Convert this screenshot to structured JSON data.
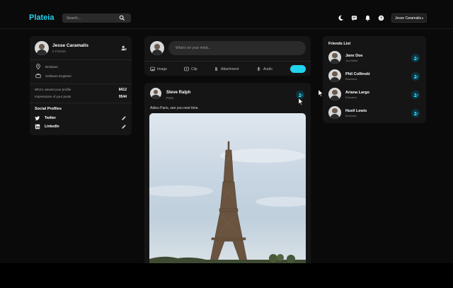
{
  "brand": {
    "logo": "Plateia",
    "accent": "#22d3ee"
  },
  "search": {
    "placeholder": "Search..."
  },
  "nav": {
    "user_label": "Jesse Caramalis",
    "icons": [
      "moon-icon",
      "chat-icon",
      "bell-icon",
      "help-icon"
    ]
  },
  "profile": {
    "name": "Jesse Caramalis",
    "friends": "5 Friends",
    "location": "Brisbane",
    "job": "Software Engineer",
    "stats": [
      {
        "label": "Who's viewed your profile",
        "value": "8412"
      },
      {
        "label": "Impressions of your posts",
        "value": "9544"
      }
    ],
    "social_title": "Social Profiles",
    "social": [
      {
        "label": "Twitter"
      },
      {
        "label": "LinkedIn"
      }
    ]
  },
  "composer": {
    "placeholder": "What's on your mind...",
    "actions": [
      "Image",
      "Clip",
      "Attachment",
      "Audio"
    ]
  },
  "post": {
    "author": "Steve Ralph",
    "location": "Paris",
    "text": "Adieu Paris, see you next time."
  },
  "friends": {
    "title": "Friends List",
    "items": [
      {
        "name": "Jane Doe",
        "role": "Journalist"
      },
      {
        "name": "Phil Collinski",
        "role": "Business"
      },
      {
        "name": "Ariana Largo",
        "role": "Educator"
      },
      {
        "name": "Hueil Lewis",
        "role": "Musician"
      }
    ]
  }
}
